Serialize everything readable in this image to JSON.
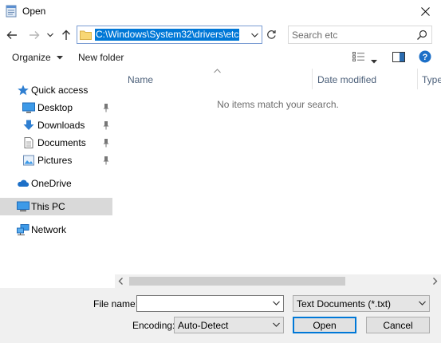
{
  "window": {
    "title": "Open",
    "close_icon": "close-icon",
    "app_icon": "notepad-icon"
  },
  "nav": {
    "back_icon": "arrow-left-icon",
    "forward_icon": "arrow-right-icon",
    "recent_icon": "chevron-down-icon",
    "up_icon": "arrow-up-icon",
    "address_path": "C:\\Windows\\System32\\drivers\\etc",
    "refresh_icon": "refresh-icon",
    "search_placeholder": "Search etc",
    "search_icon": "search-icon"
  },
  "toolbar": {
    "organize_label": "Organize",
    "new_folder_label": "New folder",
    "view_icon": "view-details-icon",
    "preview_icon": "preview-pane-icon",
    "help_icon": "help-icon",
    "help_label": "?"
  },
  "sidebar": {
    "items": [
      {
        "label": "Quick access",
        "icon": "star-icon",
        "pinned": false
      },
      {
        "label": "Desktop",
        "icon": "desktop-icon",
        "pinned": true
      },
      {
        "label": "Downloads",
        "icon": "download-icon",
        "pinned": true
      },
      {
        "label": "Documents",
        "icon": "documents-icon",
        "pinned": true
      },
      {
        "label": "Pictures",
        "icon": "pictures-icon",
        "pinned": true
      },
      {
        "label": "OneDrive",
        "icon": "cloud-icon",
        "pinned": false
      },
      {
        "label": "This PC",
        "icon": "computer-icon",
        "pinned": false,
        "selected": true
      },
      {
        "label": "Network",
        "icon": "network-icon",
        "pinned": false
      }
    ]
  },
  "filelist": {
    "columns": [
      "Name",
      "Date modified",
      "Type"
    ],
    "empty_message": "No items match your search."
  },
  "bottom": {
    "file_name_label": "File name:",
    "file_name_value": "",
    "file_type_value": "Text Documents (*.txt)",
    "encoding_label": "Encoding:",
    "encoding_value": "Auto-Detect",
    "open_label": "Open",
    "cancel_label": "Cancel"
  },
  "colors": {
    "accent": "#0078d7",
    "selection_gray": "#d9d9d9",
    "footer_bg": "#f0f0f0"
  }
}
